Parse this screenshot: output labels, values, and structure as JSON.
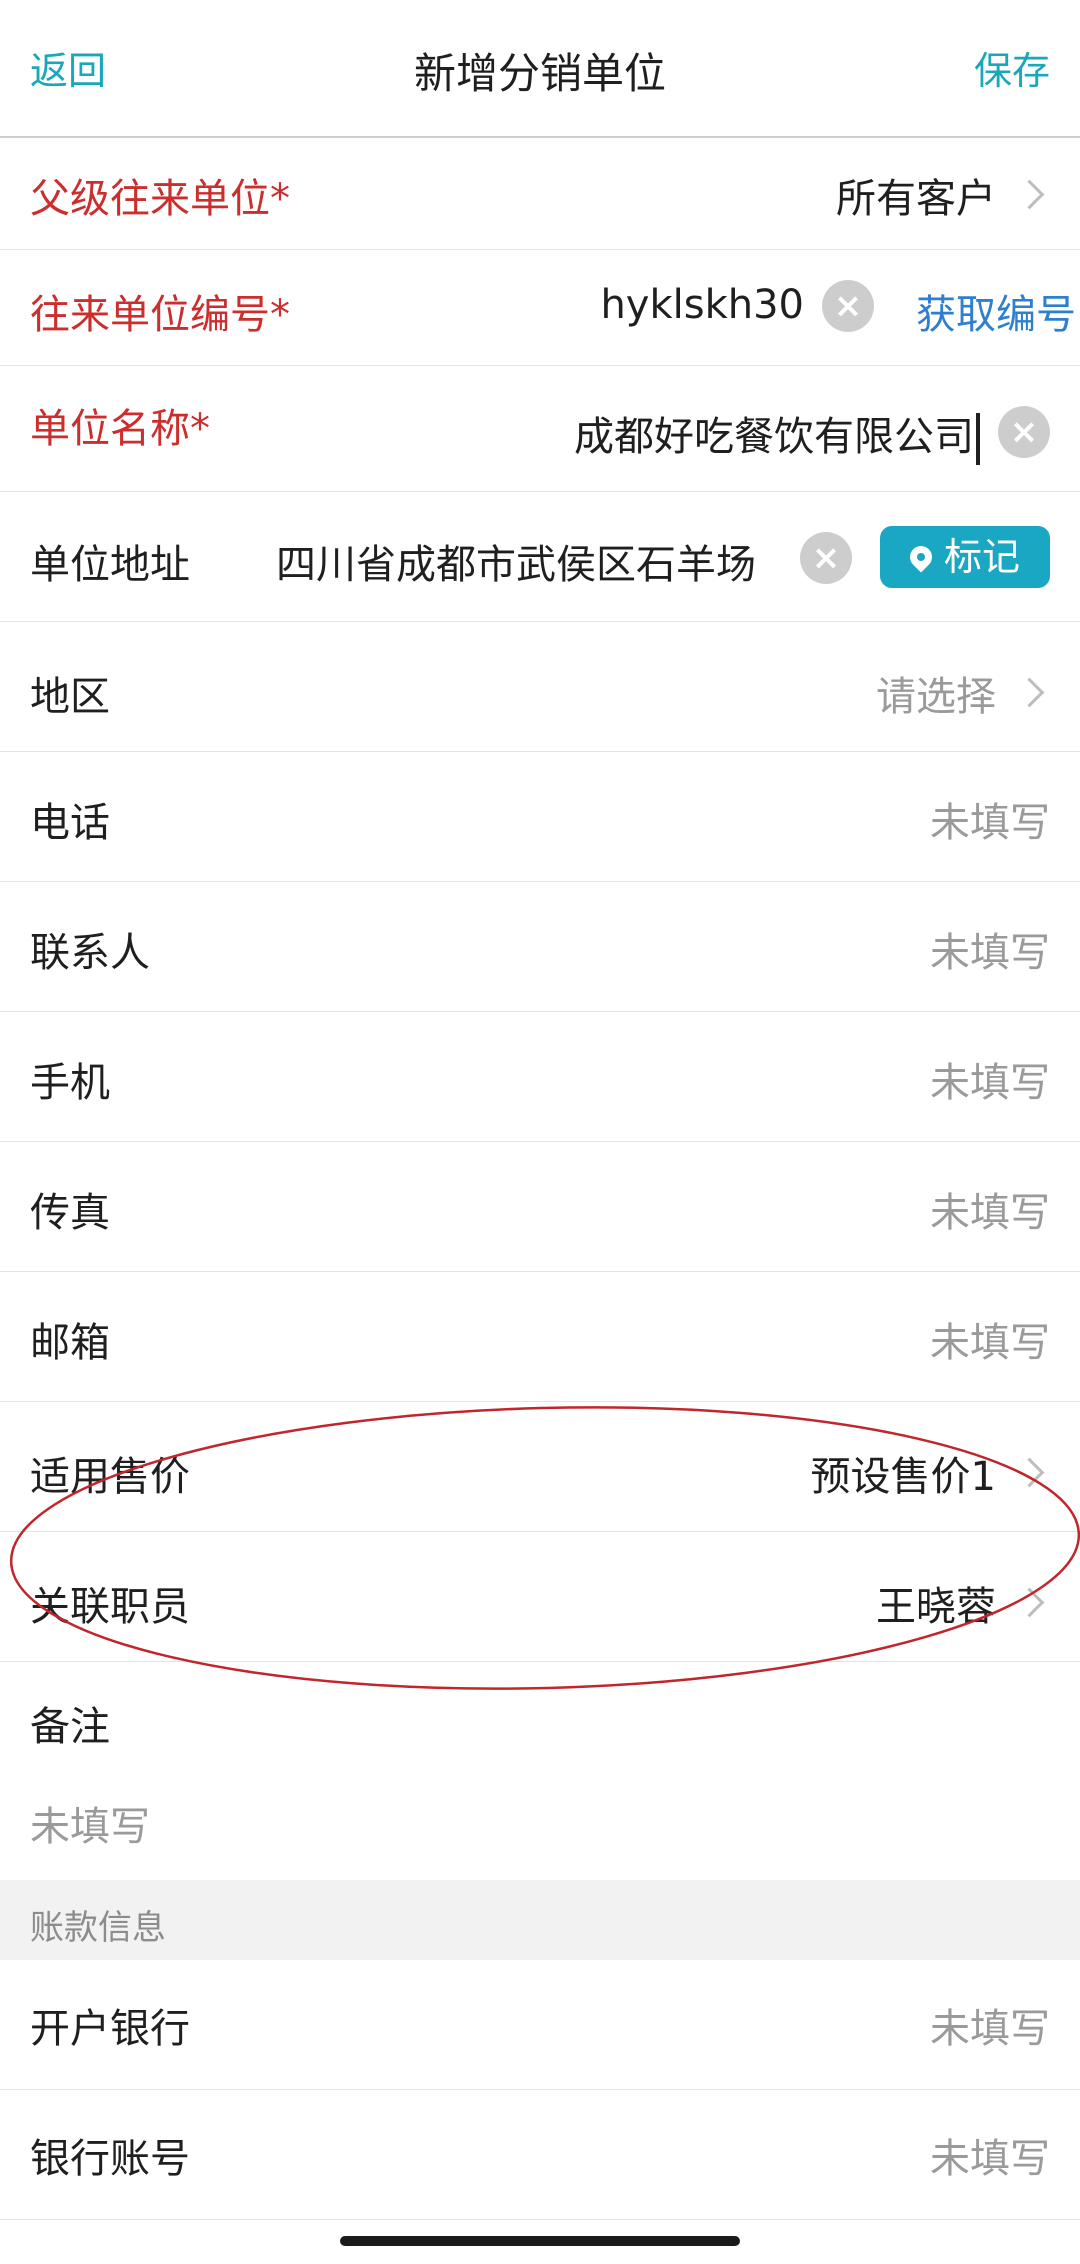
{
  "nav": {
    "back_label": "返回",
    "title": "新增分销单位",
    "save_label": "保存"
  },
  "form": {
    "parent_unit": {
      "label": "父级往来单位*",
      "value": "所有客户"
    },
    "unit_code": {
      "label": "往来单位编号*",
      "value": "hyklskh30",
      "fetch_label": "获取编号"
    },
    "unit_name": {
      "label": "单位名称*",
      "value": "成都好吃餐饮有限公司"
    },
    "unit_address": {
      "label": "单位地址",
      "value": "四川省成都市武侯区石羊场",
      "mark_label": "标记"
    },
    "region": {
      "label": "地区",
      "placeholder": "请选择"
    },
    "phone": {
      "label": "电话",
      "placeholder": "未填写"
    },
    "contact": {
      "label": "联系人",
      "placeholder": "未填写"
    },
    "mobile": {
      "label": "手机",
      "placeholder": "未填写"
    },
    "fax": {
      "label": "传真",
      "placeholder": "未填写"
    },
    "email": {
      "label": "邮箱",
      "placeholder": "未填写"
    },
    "price_level": {
      "label": "适用售价",
      "value": "预设售价1"
    },
    "staff": {
      "label": "关联职员",
      "value": "王晓蓉"
    },
    "remark": {
      "label": "备注",
      "placeholder": "未填写"
    }
  },
  "account_section": {
    "title": "账款信息",
    "bank": {
      "label": "开户银行",
      "placeholder": "未填写"
    },
    "bank_account": {
      "label": "银行账号",
      "placeholder": "未填写"
    }
  },
  "colors": {
    "accent": "#1aa7b8",
    "required": "#cc2e2e",
    "link": "#2e7fcf",
    "annotation": "#c0262b"
  },
  "icons": {
    "clear": "clear-icon",
    "chevron": "chevron-right-icon",
    "pin": "location-pin-icon"
  }
}
